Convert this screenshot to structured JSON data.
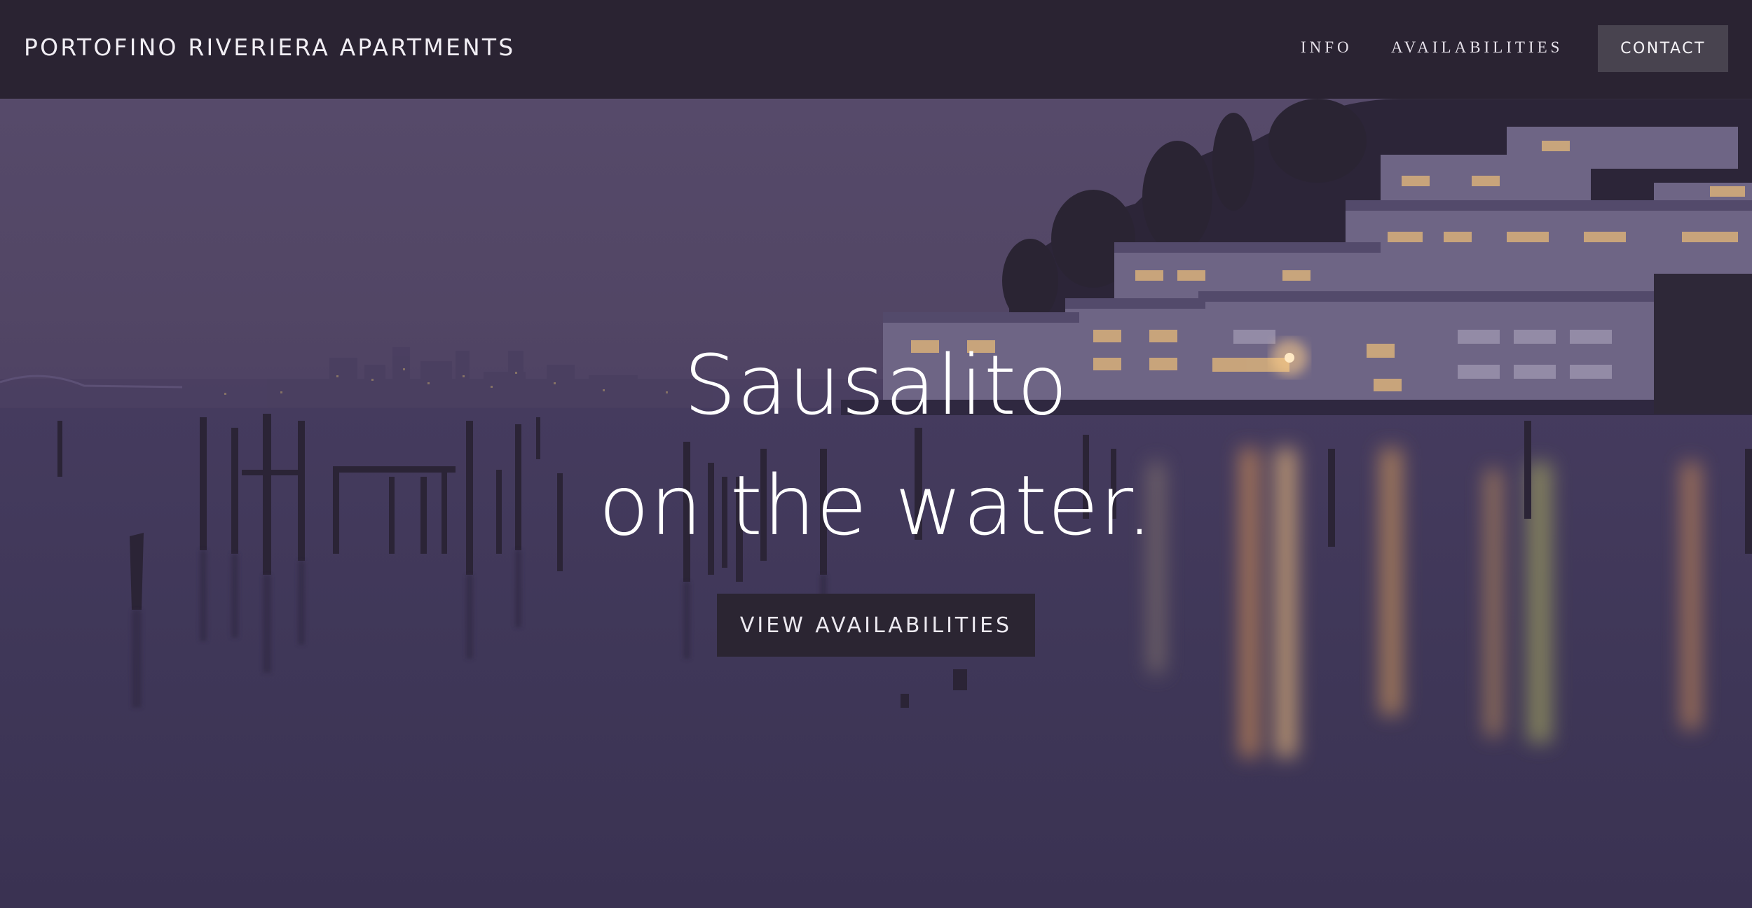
{
  "header": {
    "brand": "PORTOFINO RIVERIERA APARTMENTS",
    "nav": {
      "info": "INFO",
      "availabilities": "AVAILABILITIES",
      "contact": "CONTACT"
    }
  },
  "hero": {
    "title_line1": "Sausalito",
    "title_line2": "on the water.",
    "cta_label": "VIEW AVAILABILITIES",
    "background": "night-harbor-photo"
  },
  "colors": {
    "header_bg": "#2a2332",
    "overlay": "#4d4163",
    "button_dark": "#2b2532",
    "contact_bg": "#48434f"
  }
}
